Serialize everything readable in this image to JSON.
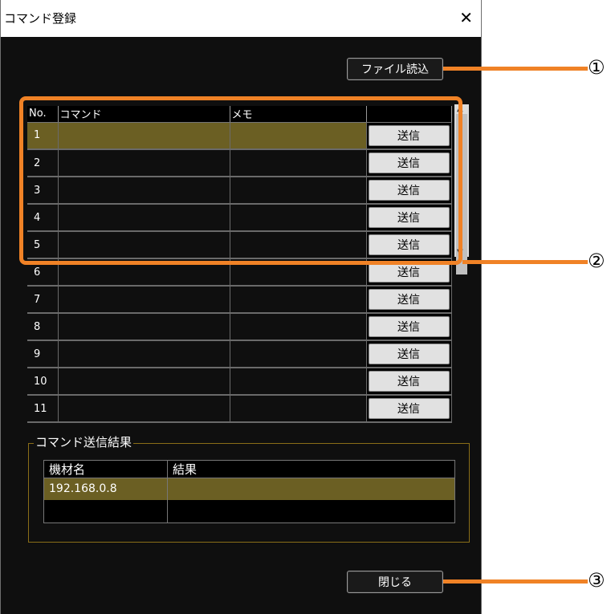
{
  "window": {
    "title": "コマンド登録",
    "close_label": "✕"
  },
  "toolbar": {
    "load_file_label": "ファイル読込"
  },
  "command_table": {
    "headers": [
      "No.",
      "コマンド",
      "メモ",
      ""
    ],
    "rows": [
      {
        "no": "1",
        "command": "",
        "memo": "",
        "send": "送信",
        "selected": true
      },
      {
        "no": "2",
        "command": "",
        "memo": "",
        "send": "送信"
      },
      {
        "no": "3",
        "command": "",
        "memo": "",
        "send": "送信"
      },
      {
        "no": "4",
        "command": "",
        "memo": "",
        "send": "送信"
      },
      {
        "no": "5",
        "command": "",
        "memo": "",
        "send": "送信"
      },
      {
        "no": "6",
        "command": "",
        "memo": "",
        "send": "送信"
      },
      {
        "no": "7",
        "command": "",
        "memo": "",
        "send": "送信"
      },
      {
        "no": "8",
        "command": "",
        "memo": "",
        "send": "送信"
      },
      {
        "no": "9",
        "command": "",
        "memo": "",
        "send": "送信"
      },
      {
        "no": "10",
        "command": "",
        "memo": "",
        "send": "送信"
      },
      {
        "no": "11",
        "command": "",
        "memo": "",
        "send": "送信"
      }
    ]
  },
  "result_group": {
    "label": "コマンド送信結果",
    "headers": [
      "機材名",
      "結果"
    ],
    "rows": [
      {
        "device": "192.168.0.8",
        "result": "",
        "selected": true
      }
    ]
  },
  "footer": {
    "close_label": "閉じる"
  },
  "callouts": {
    "one": "①",
    "two": "②",
    "three": "③"
  },
  "colors": {
    "accent_orange": "#f08226",
    "selected_row": "#6b5f23",
    "background": "#0f0f0f"
  },
  "icons": {
    "close": "close-icon",
    "scroll_up": "chevron-up-icon",
    "scroll_down": "chevron-down-icon"
  }
}
